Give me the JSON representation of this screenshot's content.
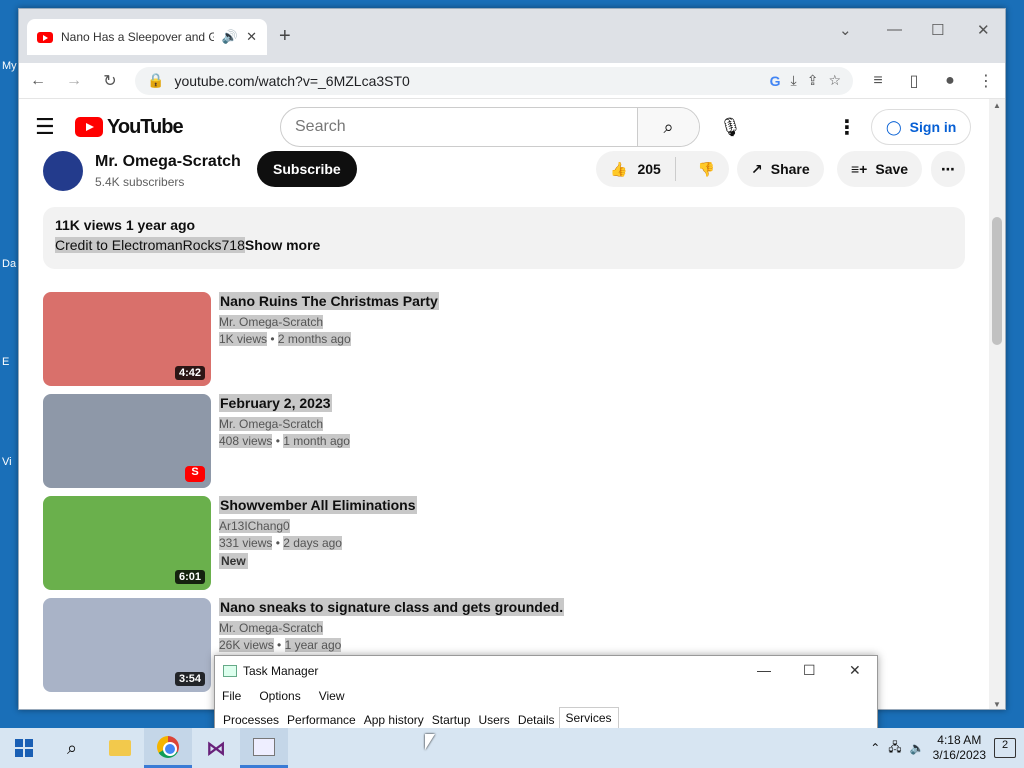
{
  "browser": {
    "tab_title": "Nano Has a Sleepover and G",
    "url": "youtube.com/watch?v=_6MZLca3ST0"
  },
  "youtube": {
    "logo_text": "YouTube",
    "search_placeholder": "Search",
    "sign_in": "Sign in"
  },
  "channel": {
    "name": "Mr. Omega-Scratch",
    "subscribers": "5.4K subscribers",
    "subscribe_label": "Subscribe",
    "likes": "205",
    "share_label": "Share",
    "save_label": "Save"
  },
  "description": {
    "meta": "11K views  1 year ago",
    "text": "Credit to ElectromanRocks718",
    "show_more": "Show more"
  },
  "related": [
    {
      "title": "Nano Ruins The Christmas Party",
      "channel": "Mr. Omega-Scratch",
      "views": "1K views",
      "age": "2 months ago",
      "duration": "4:42",
      "thumb_color": "#d9706b"
    },
    {
      "title": "February 2, 2023",
      "channel": "Mr. Omega-Scratch",
      "views": "408 views",
      "age": "1 month ago",
      "duration": "",
      "thumb_color": "#8e98a8"
    },
    {
      "title": "Showvember All Eliminations",
      "channel": "Ar13IChang0",
      "views": "331 views",
      "age": "2 days ago",
      "duration": "6:01",
      "badge": "New",
      "thumb_color": "#6ab04c"
    },
    {
      "title": "Nano sneaks to signature class and gets grounded.",
      "channel": "Mr. Omega-Scratch",
      "views": "26K views",
      "age": "1 year ago",
      "duration": "3:54",
      "thumb_color": "#a9b3c7"
    }
  ],
  "task_manager": {
    "title": "Task Manager",
    "menu": [
      "File",
      "Options",
      "View"
    ],
    "tabs": [
      "Processes",
      "Performance",
      "App history",
      "Startup",
      "Users",
      "Details",
      "Services"
    ],
    "active_tab": "Services"
  },
  "taskbar": {
    "time": "4:18 AM",
    "date": "3/16/2023",
    "notifications": "2"
  },
  "desktop_labels": [
    "My",
    "Da",
    "E",
    "Vi"
  ]
}
